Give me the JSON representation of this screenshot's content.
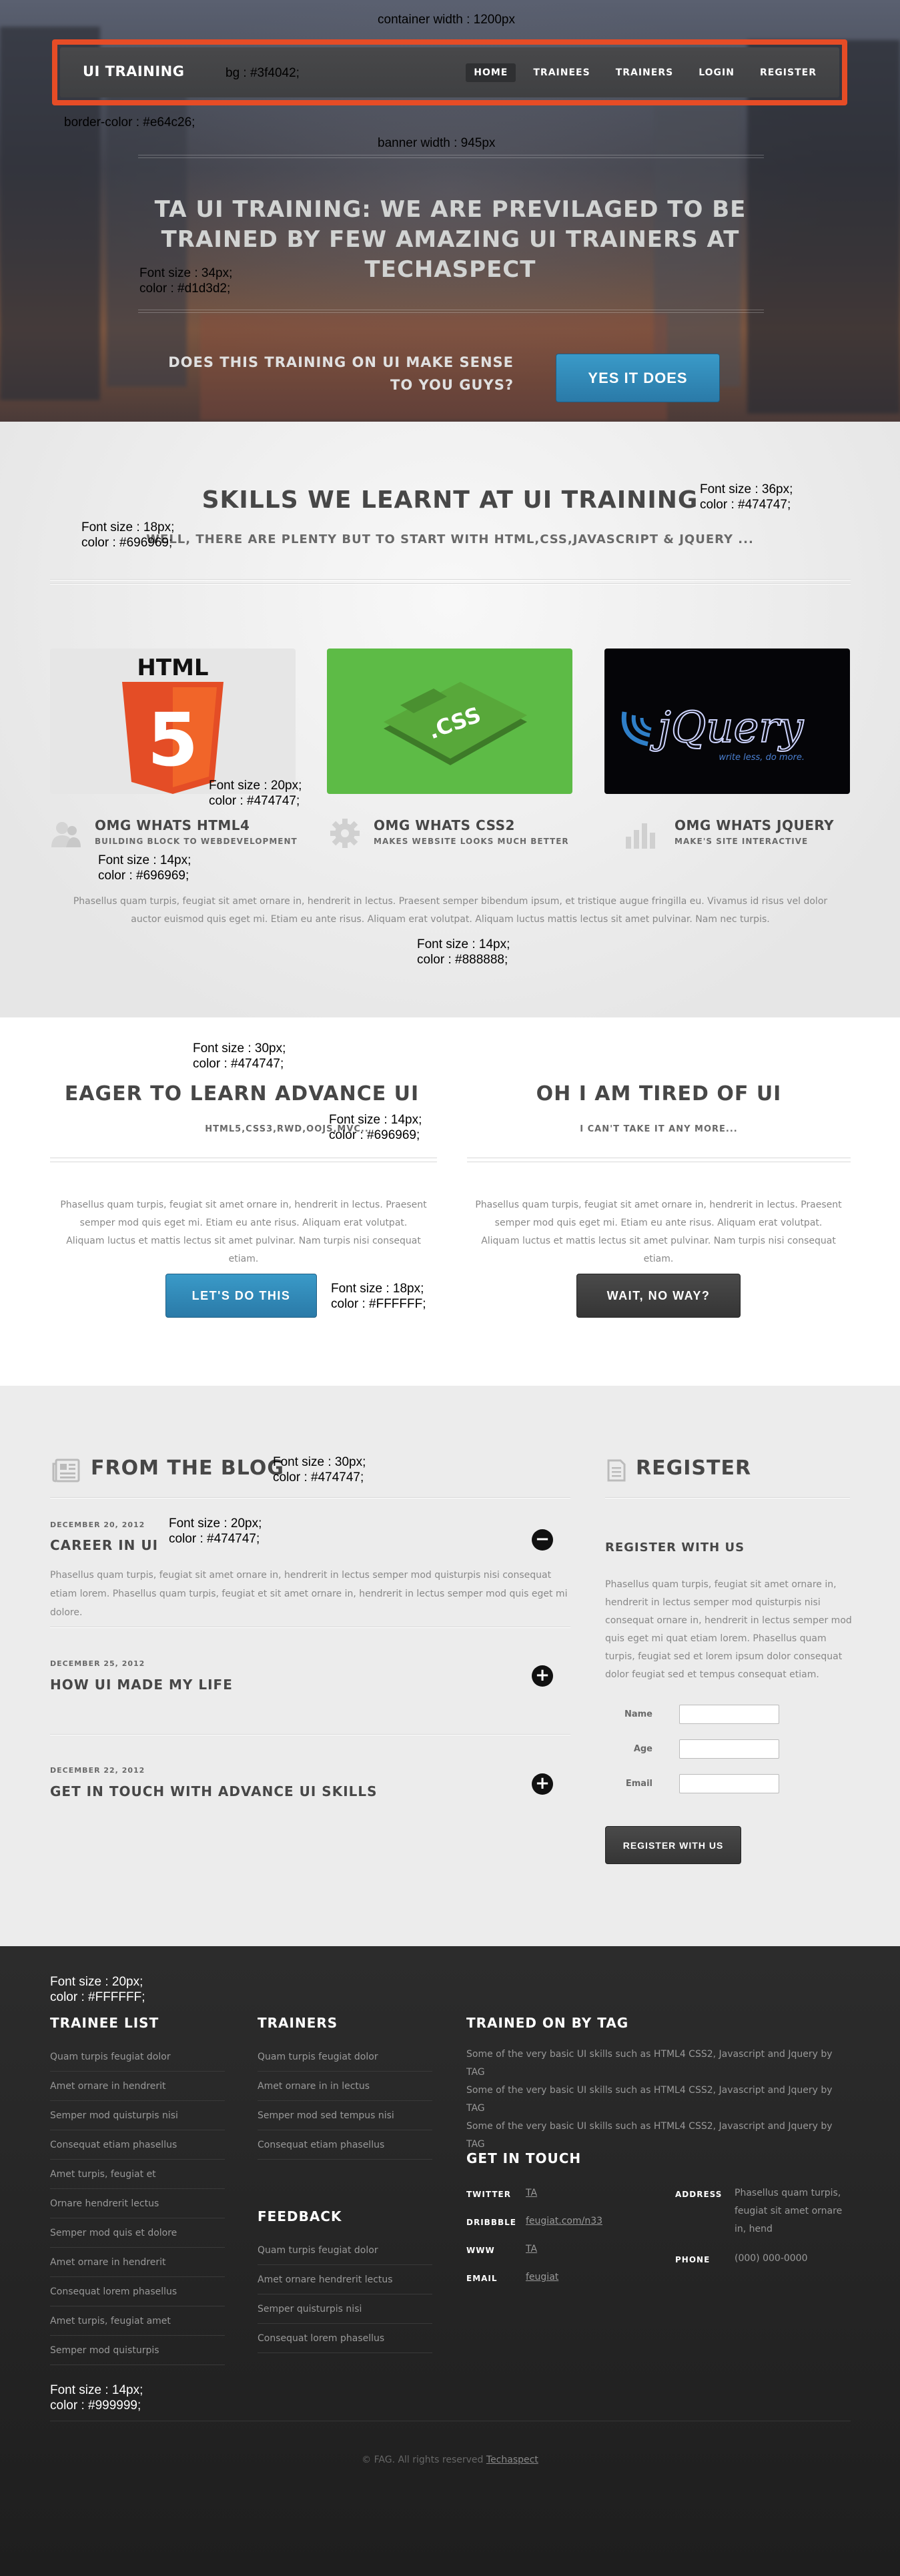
{
  "header": {
    "brand": "UI TRAINING",
    "nav": [
      "HOME",
      "TRAINEES",
      "TRAINERS",
      "LOGIN",
      "REGISTER"
    ]
  },
  "hero": {
    "title": "TA UI TRAINING: WE ARE PREVILAGED TO BE TRAINED BY FEW AMAZING UI TRAINERS AT TECHASPECT",
    "question": "DOES THIS TRAINING ON UI MAKE SENSE TO YOU GUYS?",
    "cta": "YES IT DOES"
  },
  "annotations": {
    "container_width": "container width : 1200px",
    "nav_bg": "bg : #3f4042;",
    "border_color": "border-color : #e64c26;",
    "banner_width": "banner width : 945px",
    "hero_title_size": "Font size : 34px;",
    "hero_title_color": "color : #d1d3d2;",
    "skills_title_size": "Font size : 36px;",
    "skills_title_color": "color : #474747;",
    "skills_sub_size": "Font size : 18px;",
    "skills_sub_color": "color : #696969;",
    "feat_title_size": "Font size : 20px;",
    "feat_title_color": "color : #474747;",
    "feat_sub_size": "Font size : 14px;",
    "feat_sub_color": "color : #696969;",
    "para_size": "Font size : 14px;",
    "para_color": "color : #888888;",
    "eager_title_size": "Font size : 30px;",
    "eager_title_color": "color : #474747;",
    "eager_sub_size": "Font size : 14px;",
    "eager_sub_color": "color : #696969;",
    "btn_size": "Font size : 18px;",
    "btn_color": "color : #FFFFFF;",
    "blog_title_size": "Font size : 30px;",
    "blog_title_color": "color : #474747;",
    "post_title_size": "Font size : 20px;",
    "post_title_color": "color : #474747;",
    "foot_head_size": "Font size : 20px;",
    "foot_head_color": "color : #FFFFFF;",
    "foot_text_size": "Font size : 14px;",
    "foot_text_color": "color : #999999;"
  },
  "skills": {
    "title": "SKILLS WE LEARNT AT UI TRAINING",
    "subtitle": "WELL, THERE ARE PLENTY BUT TO START WITH HTML,CSS,JAVASCRIPT & JQUERY ...",
    "tiles": {
      "html": "HTML",
      "html_num": "5",
      "css": ".CSS",
      "jquery": "jQuery",
      "jquery_tag": "write less, do more."
    },
    "features": [
      {
        "title": "OMG WHATS HTML4",
        "subtitle": "BUILDING BLOCK TO WEBDEVELOPMENT"
      },
      {
        "title": "OMG WHATS CSS2",
        "subtitle": "MAKES WEBSITE LOOKS MUCH BETTER"
      },
      {
        "title": "OMG WHATS JQUERY",
        "subtitle": "MAKE'S SITE INTERACTIVE"
      }
    ],
    "paragraph": "Phasellus quam turpis, feugiat sit amet ornare in, hendrerit in lectus. Praesent semper bibendum ipsum, et tristique augue fringilla eu. Vivamus id risus vel dolor auctor euismod quis eget mi. Etiam eu ante risus. Aliquam erat volutpat. Aliquam luctus mattis lectus sit amet pulvinar. Nam nec turpis."
  },
  "eager": {
    "left": {
      "title": "EAGER TO LEARN ADVANCE UI",
      "subtitle": "HTML5,CSS3,RWD,OOJS,MVC..",
      "paragraph": "Phasellus quam turpis, feugiat sit amet ornare in, hendrerit in lectus. Praesent semper mod quis eget mi. Etiam eu ante risus. Aliquam erat volutpat. Aliquam luctus et mattis lectus sit amet pulvinar. Nam turpis nisi consequat etiam.",
      "button": "LET'S DO THIS"
    },
    "right": {
      "title": "OH I AM TIRED OF UI",
      "subtitle": "I CAN'T TAKE IT ANY MORE...",
      "paragraph": "Phasellus quam turpis, feugiat sit amet ornare in, hendrerit in lectus. Praesent semper mod quis eget mi. Etiam eu ante risus. Aliquam erat volutpat. Aliquam luctus et mattis lectus sit amet pulvinar. Nam turpis nisi consequat etiam.",
      "button": "WAIT, NO WAY?"
    }
  },
  "blog": {
    "title": "FROM THE BLOG",
    "posts": [
      {
        "date": "DECEMBER 20, 2012",
        "title": "CAREER IN UI",
        "toggle": "−",
        "paragraph": "Phasellus quam turpis, feugiat sit amet ornare in, hendrerit in lectus semper mod quisturpis nisi consequat etiam lorem. Phasellus quam turpis, feugiat et sit amet ornare in, hendrerit in lectus semper mod quis eget mi dolore."
      },
      {
        "date": "DECEMBER 25, 2012",
        "title": "HOW UI MADE MY LIFE",
        "toggle": "+"
      },
      {
        "date": "DECEMBER 22, 2012",
        "title": "GET IN TOUCH WITH ADVANCE UI SKILLS",
        "toggle": "+"
      }
    ]
  },
  "register": {
    "title": "REGISTER",
    "subtitle": "REGISTER WITH US",
    "paragraph": "Phasellus quam turpis, feugiat sit amet ornare in, hendrerit in lectus semper mod quisturpis nisi consequat ornare in, hendrerit in lectus semper mod quis eget mi quat etiam lorem. Phasellus quam turpis, feugiat sed et lorem ipsum dolor consequat dolor feugiat sed et tempus consequat etiam.",
    "fields": [
      "Name",
      "Age",
      "Email"
    ],
    "button": "REGISTER WITH US"
  },
  "footer": {
    "trainee_title": "TRAINEE LIST",
    "trainees": [
      "Quam turpis feugiat dolor",
      "Amet ornare in hendrerit",
      "Semper mod quisturpis nisi",
      "Consequat etiam phasellus",
      "Amet turpis, feugiat et",
      "Ornare hendrerit lectus",
      "Semper mod quis et dolore",
      "Amet ornare in hendrerit",
      "Consequat lorem phasellus",
      "Amet turpis, feugiat amet",
      "Semper mod quisturpis"
    ],
    "trainers_title": "TRAINERS",
    "trainers": [
      "Quam turpis feugiat dolor",
      "Amet ornare in in lectus",
      "Semper mod sed tempus nisi",
      "Consequat etiam phasellus"
    ],
    "feedback_title": "FEEDBACK",
    "feedback": [
      "Quam turpis feugiat dolor",
      "Amet ornare hendrerit lectus",
      "Semper quisturpis nisi",
      "Consequat lorem phasellus"
    ],
    "tag_title": "TRAINED ON BY TAG",
    "tag_lines": [
      "Some of the very basic UI skills such as HTML4 CSS2, Javascript and Jquery by TAG",
      "Some of the very basic UI skills such as HTML4 CSS2, Javascript and Jquery by TAG",
      "Some of the very basic UI skills such as HTML4 CSS2, Javascript and Jquery by TAG"
    ],
    "contact_title": "GET IN TOUCH",
    "contact": {
      "twitter_label": "TWITTER",
      "twitter": "TA",
      "dribbble_label": "DRIBBBLE",
      "dribbble": "feugiat.com/n33",
      "www_label": "WWW",
      "www": "TA",
      "email_label": "EMAIL",
      "email": "feugiat",
      "address_label": "ADDRESS",
      "address": "Phasellus quam turpis, feugiat sit amet ornare in, hend",
      "phone_label": "PHONE",
      "phone": "(000) 000-0000"
    },
    "copyright": "© FAG. All rights reserved",
    "copyright_link": "Techaspect"
  }
}
